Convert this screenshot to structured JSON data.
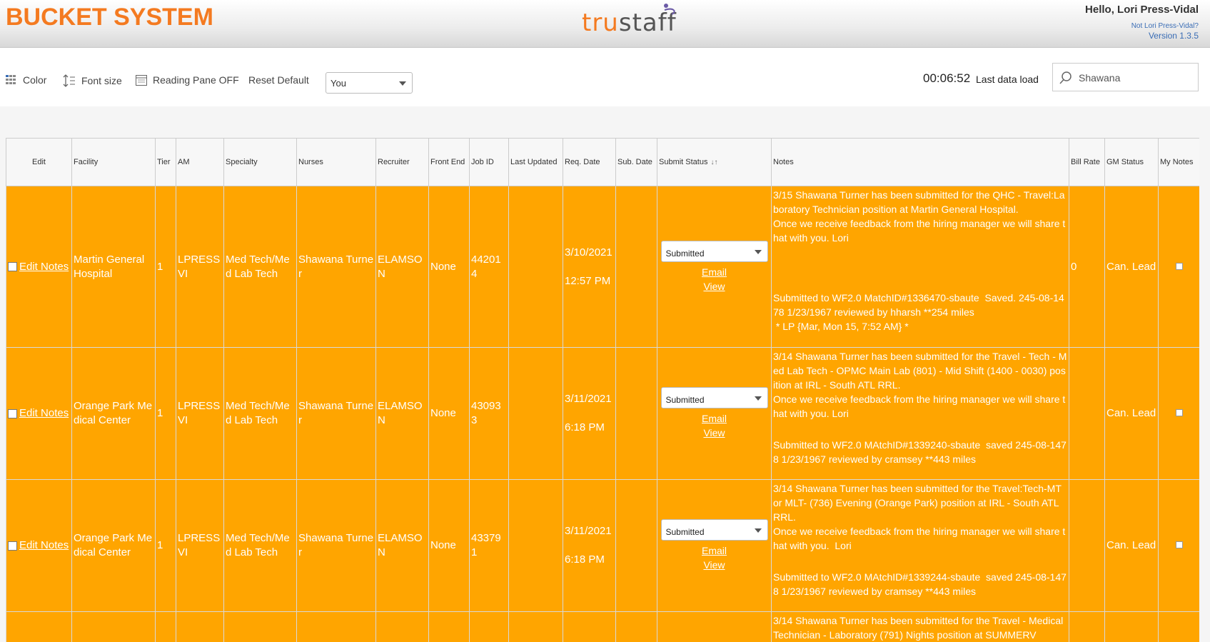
{
  "header": {
    "app_title": "BUCKET SYSTEM",
    "logo_text_a": "tru",
    "logo_text_b": "staff",
    "greeting": "Hello, Lori Press-Vidal",
    "not_user_link": "Not Lori Press-Vidal?",
    "version": "Version 1.3.5"
  },
  "toolbar": {
    "color_label": "Color",
    "font_size_label": "Font size",
    "reading_pane_label": "Reading Pane OFF",
    "reset_label": "Reset Default",
    "owner_select_value": "You",
    "timer": "00:06:52",
    "last_load_label": "Last data load",
    "search_value": "Shawana"
  },
  "table": {
    "headers": {
      "edit": "Edit",
      "facility": "Facility",
      "tier": "Tier",
      "am": "AM",
      "specialty": "Specialty",
      "nurses": "Nurses",
      "recruiter": "Recruiter",
      "front_end": "Front End",
      "job_id": "Job ID",
      "last_updated": "Last Updated",
      "req_date": "Req. Date",
      "sub_date": "Sub. Date",
      "submit_status": "Submit Status",
      "notes": "Notes",
      "bill_rate": "Bill Rate",
      "gm_status": "GM Status",
      "my_notes": "My Notes"
    },
    "rows": [
      {
        "edit_link": "Edit Notes",
        "facility": "Martin General Hospital",
        "tier": "1",
        "am": "LPRESSVI",
        "specialty": "Med Tech/Med Lab Tech",
        "nurse": "Shawana Turner",
        "recruiter": "ELAMSON",
        "front_end": "None",
        "job_id": "442014",
        "last_updated": "",
        "req_date": "3/10/2021",
        "req_time": "12:57 PM",
        "sub_date": "",
        "status": "Submitted",
        "email_link": "Email",
        "view_link": "View",
        "notes_a": "3/15 Shawana Turner has been submitted for the QHC - Travel:Laboratory Technician position at Martin General Hospital.\nOnce we receive feedback from the hiring manager we will share that with you. Lori",
        "notes_b": "Submitted to WF2.0 MatchID#1336470-sbaute  Saved. 245-08-1478 1/23/1967 reviewed by hharsh **254 miles\n * LP {Mar, Mon 15, 7:52 AM} *",
        "bill_rate": "0",
        "gm_status": "Can. Lead"
      },
      {
        "edit_link": "Edit Notes",
        "facility": "Orange Park Medical Center",
        "tier": "1",
        "am": "LPRESSVI",
        "specialty": "Med Tech/Med Lab Tech",
        "nurse": "Shawana Turner",
        "recruiter": "ELAMSON",
        "front_end": "None",
        "job_id": "430933",
        "last_updated": "",
        "req_date": "3/11/2021",
        "req_time": "6:18 PM",
        "sub_date": "",
        "status": "Submitted",
        "email_link": "Email",
        "view_link": "View",
        "notes_a": "3/14 Shawana Turner has been submitted for the Travel - Tech - Med Lab Tech - OPMC Main Lab (801) - Mid Shift (1400 - 0030) position at IRL - South ATL RRL.\nOnce we receive feedback from the hiring manager we will share that with you. Lori",
        "notes_b": "Submitted to WF2.0 MAtchID#1339240-sbaute  saved 245-08-1478 1/23/1967 reviewed by cramsey **443 miles",
        "bill_rate": "",
        "gm_status": "Can. Lead"
      },
      {
        "edit_link": "Edit Notes",
        "facility": "Orange Park Medical Center",
        "tier": "1",
        "am": "LPRESSVI",
        "specialty": "Med Tech/Med Lab Tech",
        "nurse": "Shawana Turner",
        "recruiter": "ELAMSON",
        "front_end": "None",
        "job_id": "433791",
        "last_updated": "",
        "req_date": "3/11/2021",
        "req_time": "6:18 PM",
        "sub_date": "",
        "status": "Submitted",
        "email_link": "Email",
        "view_link": "View",
        "notes_a": "3/14 Shawana Turner has been submitted for the Travel:Tech-MT or MLT- (736) Evening (Orange Park) position at IRL - South ATL RRL.\nOnce we receive feedback from the hiring manager we will share that with you.  Lori",
        "notes_b": "Submitted to WF2.0 MAtchID#1339244-sbaute  saved 245-08-1478 1/23/1967 reviewed by cramsey **443 miles",
        "bill_rate": "",
        "gm_status": "Can. Lead"
      },
      {
        "notes_a": "3/14 Shawana Turner has been submitted for the Travel - Medical Technician - Laboratory (791) Nights position at SUMMERV"
      }
    ]
  }
}
